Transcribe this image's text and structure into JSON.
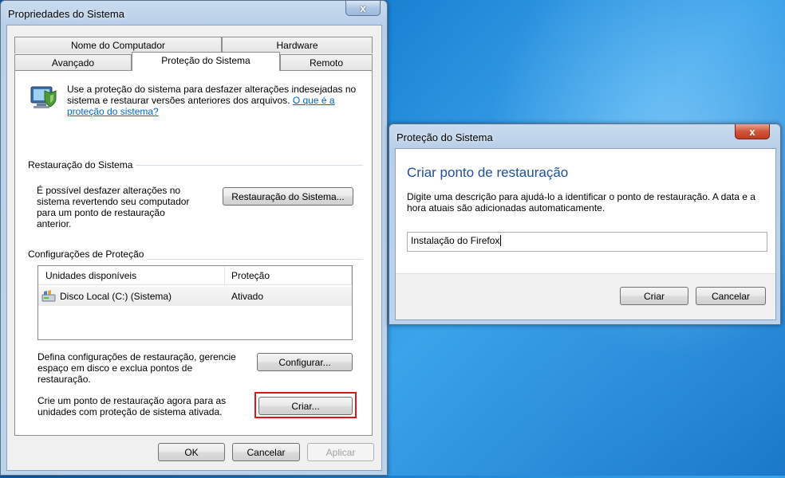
{
  "props_window": {
    "title": "Propriedades do Sistema",
    "close_label": "x",
    "tabs_row1": [
      "Nome do Computador",
      "Hardware"
    ],
    "tabs_row2": [
      "Avançado",
      "Proteção do Sistema",
      "Remoto"
    ],
    "intro_text": "Use a proteção do sistema para desfazer alterações indesejadas no sistema e restaurar versões anteriores dos arquivos.",
    "intro_link": "O que é a proteção do sistema?",
    "restore_group": "Restauração do Sistema",
    "restore_desc": "É possível desfazer alterações no sistema revertendo seu computador para um ponto de restauração anterior.",
    "restore_button": "Restauração do Sistema...",
    "protection_group": "Configurações de Proteção",
    "columns": [
      "Unidades disponíveis",
      "Proteção"
    ],
    "rows": [
      {
        "drive": "Disco Local (C:) (Sistema)",
        "status": "Ativado"
      }
    ],
    "configure_desc": "Defina configurações de restauração, gerencie espaço em disco e exclua pontos de restauração.",
    "configure_button": "Configurar...",
    "create_desc": "Crie um ponto de restauração agora para as unidades com proteção de sistema ativada.",
    "create_button": "Criar...",
    "ok_button": "OK",
    "cancel_button": "Cancelar",
    "apply_button": "Aplicar"
  },
  "protect_dialog": {
    "title": "Proteção do Sistema",
    "close_label": "x",
    "heading": "Criar ponto de restauração",
    "description": "Digite uma descrição para ajudá-lo a identificar o ponto de restauração. A data e a hora atuais são adicionadas automaticamente.",
    "input_value": "Instalação do Firefox",
    "create_button": "Criar",
    "cancel_button": "Cancelar"
  },
  "colors": {
    "highlight_outline": "#e0141b",
    "heading_blue": "#1f4e9d",
    "link_blue": "#0066cc"
  }
}
